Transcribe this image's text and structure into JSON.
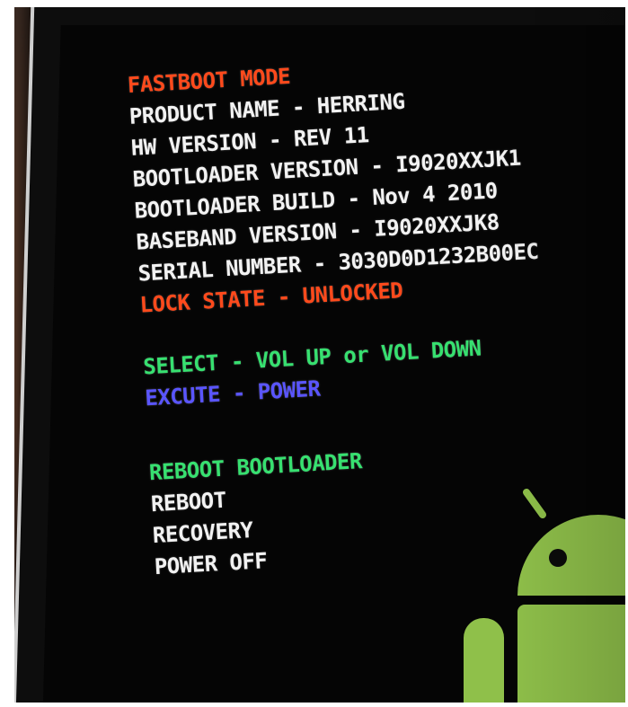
{
  "screen": {
    "lines": [
      {
        "text": "FASTBOOT MODE",
        "color": "#ff4a1c"
      },
      {
        "text": "PRODUCT NAME - HERRING",
        "color": "#f2f2f2"
      },
      {
        "text": "HW VERSION - REV 11",
        "color": "#f2f2f2"
      },
      {
        "text": "BOOTLOADER VERSION - I9020XXJK1",
        "color": "#f2f2f2"
      },
      {
        "text": "BOOTLOADER BUILD - Nov  4 2010",
        "color": "#f2f2f2"
      },
      {
        "text": "BASEBAND VERSION - I9020XXJK8",
        "color": "#f2f2f2"
      },
      {
        "text": "SERIAL NUMBER - 3030D0D1232B00EC",
        "color": "#f2f2f2"
      },
      {
        "text": "LOCK STATE - UNLOCKED",
        "color": "#ff4a1c"
      }
    ],
    "controls": [
      {
        "text": "SELECT - VOL UP or VOL DOWN",
        "color": "#37e070"
      },
      {
        "text": "EXCUTE - POWER",
        "color": "#5a55ff"
      }
    ],
    "menu": [
      {
        "text": "REBOOT BOOTLOADER",
        "color": "#37e070"
      },
      {
        "text": "REBOOT",
        "color": "#f2f2f2"
      },
      {
        "text": "RECOVERY",
        "color": "#f2f2f2"
      },
      {
        "text": "POWER OFF",
        "color": "#f2f2f2"
      }
    ]
  },
  "mascot": {
    "icon": "android-robot-icon",
    "color": "#8fc04a"
  }
}
